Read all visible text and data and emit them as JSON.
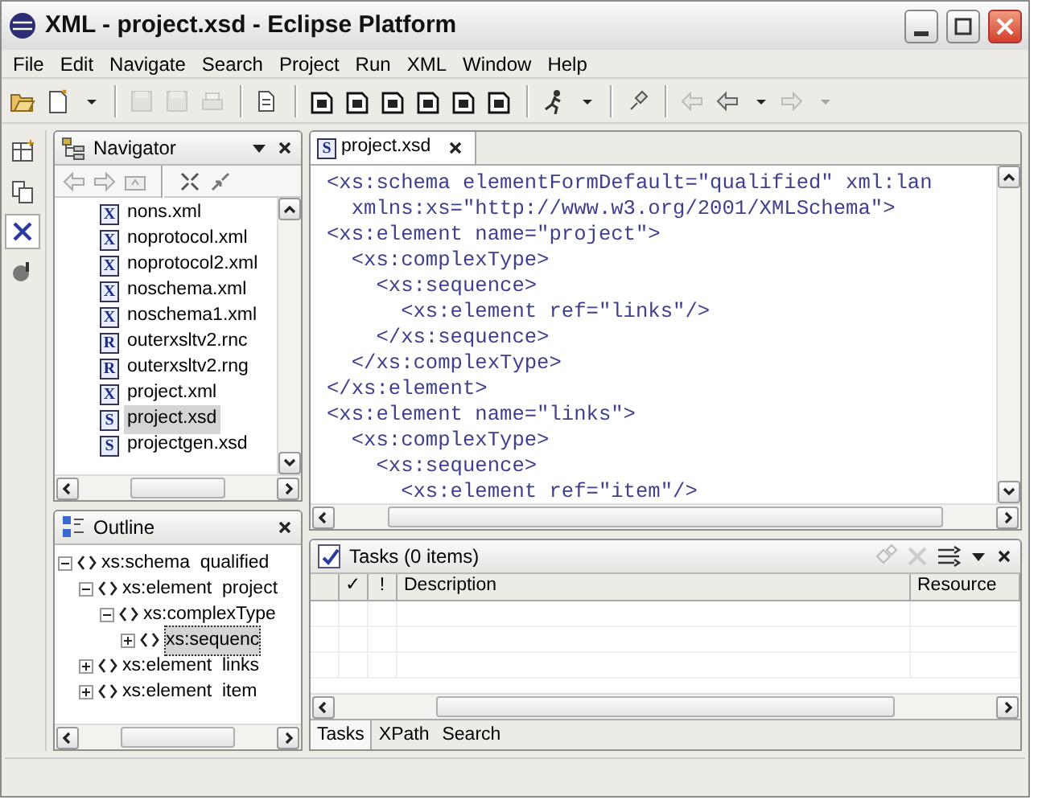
{
  "window": {
    "title": "XML - project.xsd - Eclipse Platform"
  },
  "menu": [
    "File",
    "Edit",
    "Navigate",
    "Search",
    "Project",
    "Run",
    "XML",
    "Window",
    "Help"
  ],
  "toolbar": [
    {
      "kind": "open",
      "disabled": false
    },
    {
      "kind": "new",
      "disabled": false
    },
    {
      "kind": "dropdown",
      "disabled": false
    },
    {
      "kind": "sep"
    },
    {
      "kind": "save",
      "disabled": true
    },
    {
      "kind": "save",
      "disabled": true
    },
    {
      "kind": "print",
      "disabled": true
    },
    {
      "kind": "sep"
    },
    {
      "kind": "file",
      "disabled": false
    },
    {
      "kind": "sep"
    },
    {
      "kind": "doc",
      "disabled": false
    },
    {
      "kind": "doc",
      "disabled": false
    },
    {
      "kind": "doc",
      "disabled": false
    },
    {
      "kind": "doc",
      "disabled": false
    },
    {
      "kind": "doc",
      "disabled": false
    },
    {
      "kind": "doc",
      "disabled": false
    },
    {
      "kind": "sep"
    },
    {
      "kind": "run",
      "disabled": false
    },
    {
      "kind": "dropdown",
      "disabled": false
    },
    {
      "kind": "sep"
    },
    {
      "kind": "pin",
      "disabled": false
    },
    {
      "kind": "sep"
    },
    {
      "kind": "back",
      "disabled": true
    },
    {
      "kind": "back",
      "disabled": false
    },
    {
      "kind": "dropdown",
      "disabled": false
    },
    {
      "kind": "forward",
      "disabled": true
    },
    {
      "kind": "dropdown",
      "disabled": true
    }
  ],
  "shortcuts": [
    {
      "kind": "perspective",
      "selected": false
    },
    {
      "kind": "copy",
      "selected": false
    },
    {
      "kind": "xml",
      "selected": true
    },
    {
      "kind": "java",
      "selected": false
    }
  ],
  "navigator": {
    "title": "Navigator",
    "items": [
      {
        "icon": "X",
        "name": "nons.xml",
        "selected": false
      },
      {
        "icon": "X",
        "name": "noprotocol.xml",
        "selected": false
      },
      {
        "icon": "X",
        "name": "noprotocol2.xml",
        "selected": false
      },
      {
        "icon": "X",
        "name": "noschema.xml",
        "selected": false
      },
      {
        "icon": "X",
        "name": "noschema1.xml",
        "selected": false
      },
      {
        "icon": "R",
        "name": "outerxsltv2.rnc",
        "selected": false
      },
      {
        "icon": "R",
        "name": "outerxsltv2.rng",
        "selected": false
      },
      {
        "icon": "X",
        "name": "project.xml",
        "selected": false
      },
      {
        "icon": "S",
        "name": "project.xsd",
        "selected": true
      },
      {
        "icon": "S",
        "name": "projectgen.xsd",
        "selected": false
      }
    ]
  },
  "outline": {
    "title": "Outline",
    "tree": [
      {
        "label": "xs:schema  qualified",
        "expanded": true,
        "selected": false,
        "children": [
          {
            "label": "xs:element  project",
            "expanded": true,
            "selected": false,
            "children": [
              {
                "label": "xs:complexType",
                "expanded": true,
                "selected": false,
                "children": [
                  {
                    "label": "xs:sequenc",
                    "expanded": false,
                    "selected": true
                  }
                ]
              }
            ]
          },
          {
            "label": "xs:element  links",
            "expanded": false,
            "selected": false
          },
          {
            "label": "xs:element  item",
            "expanded": false,
            "selected": false
          }
        ]
      }
    ]
  },
  "editor": {
    "tab": {
      "icon": "S",
      "label": "project.xsd",
      "selected": true
    },
    "lines": [
      "<xs:schema elementFormDefault=\"qualified\" xml:lan",
      "  xmlns:xs=\"http://www.w3.org/2001/XMLSchema\">",
      "<xs:element name=\"project\">",
      "  <xs:complexType>",
      "    <xs:sequence>",
      "      <xs:element ref=\"links\"/>",
      "    </xs:sequence>",
      "  </xs:complexType>",
      "</xs:element>",
      "<xs:element name=\"links\">",
      "  <xs:complexType>",
      "    <xs:sequence>",
      "      <xs:element ref=\"item\"/>"
    ]
  },
  "tasks": {
    "title": "Tasks (0 items)",
    "columns": [
      "✓",
      "!",
      "Description",
      "Resource"
    ],
    "tabs": [
      {
        "label": "Tasks",
        "selected": true
      },
      {
        "label": "XPath",
        "selected": false
      },
      {
        "label": "Search",
        "selected": false
      }
    ]
  }
}
